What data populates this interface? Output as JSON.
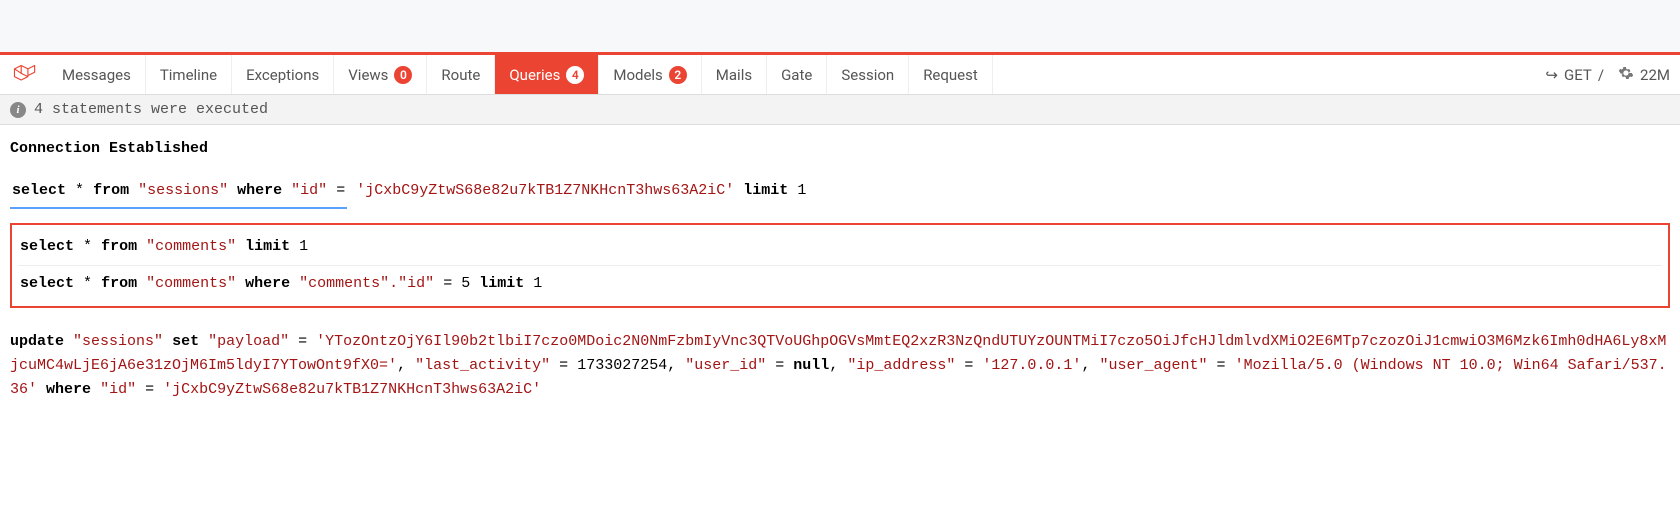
{
  "toolbar": {
    "tabs": {
      "messages": "Messages",
      "timeline": "Timeline",
      "exceptions": "Exceptions",
      "views": "Views",
      "views_count": "0",
      "route": "Route",
      "queries": "Queries",
      "queries_count": "4",
      "models": "Models",
      "models_count": "2",
      "mails": "Mails",
      "gate": "Gate",
      "session": "Session",
      "request": "Request"
    },
    "right": {
      "method": "GET",
      "path": "/",
      "mem": "22M"
    }
  },
  "status": {
    "text": "4 statements were executed"
  },
  "heading": {
    "connection": "Connection Established"
  },
  "queries": {
    "q1": {
      "select": "select",
      "star": "*",
      "from": "from",
      "table": "\"sessions\"",
      "where": "where",
      "col": "\"id\"",
      "eq": "=",
      "val": "'jCxbC9yZtwS68e82u7kTB1Z7NKHcnT3hws63A2iC'",
      "limit": "limit",
      "limit_n": "1"
    },
    "q2": {
      "select": "select",
      "star": "*",
      "from": "from",
      "table": "\"comments\"",
      "limit": "limit",
      "limit_n": "1"
    },
    "q3": {
      "select": "select",
      "star": "*",
      "from": "from",
      "table": "\"comments\"",
      "where": "where",
      "col": "\"comments\".\"id\"",
      "eq": "=",
      "val": "5",
      "limit": "limit",
      "limit_n": "1"
    },
    "q4": {
      "update": "update",
      "table": "\"sessions\"",
      "set": "set",
      "payload_col": "\"payload\"",
      "eq": "=",
      "payload_val": "'YTozOntzOjY6Il90b2tlbiI7czo0MDoic2N0NmFzbmIyVnc3QTVoUGhpOGVsMmtEQ2xzR3NzQndUTUYzOUNTMiI7czo5OiJfcHJldmlvdXMiO2E6MTp7czozOiJ1cmwiO3M6Mzk6Imh0dHA6Ly8xMjcuMC4wLjE6jA6e31zOjM6Im5ldyI7YTowOnt9fX0='",
      "comma1": ",",
      "last_activity_col": "\"last_activity\"",
      "last_activity_val": "1733027254",
      "comma2": ",",
      "user_id_col": "\"user_id\"",
      "null": "null",
      "comma3": ",",
      "ip_col": "\"ip_address\"",
      "ip_val": "'127.0.0.1'",
      "comma4": ",",
      "ua_col": "\"user_agent\"",
      "ua_val": "'Mozilla/5.0 (Windows NT 10.0; Win64 Safari/537.36'",
      "where": "where",
      "where_col": "\"id\"",
      "where_val": "'jCxbC9yZtwS68e82u7kTB1Z7NKHcnT3hws63A2iC'"
    }
  }
}
